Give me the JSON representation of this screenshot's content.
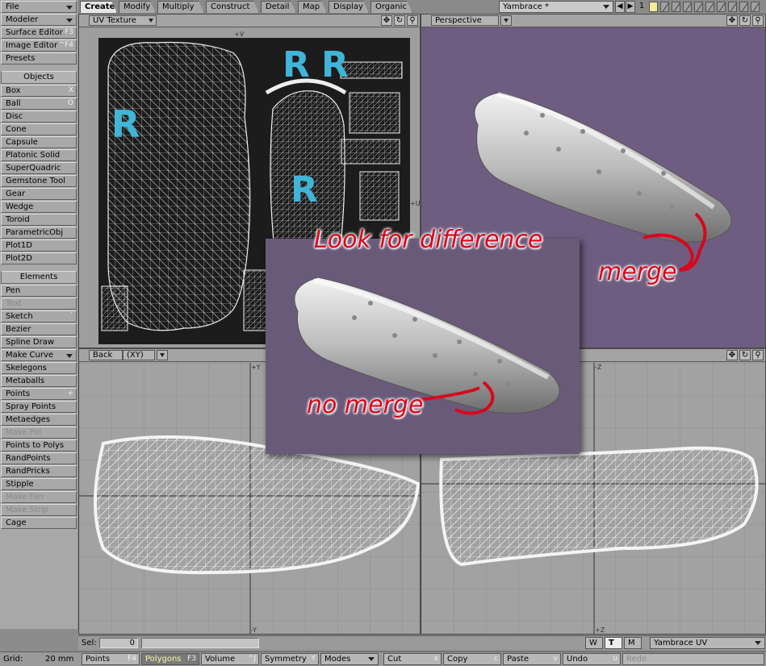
{
  "sidebar": {
    "file_label": "File",
    "modeler_label": "Modeler",
    "surface_editor": {
      "label": "Surface Editor",
      "shortcut": "F3"
    },
    "image_editor": {
      "label": "Image Editor",
      "shortcut": "^F4"
    },
    "presets_label": "Presets",
    "objects_header": "Objects",
    "objects": [
      {
        "label": "Box",
        "shortcut": "X"
      },
      {
        "label": "Ball",
        "shortcut": "O"
      },
      {
        "label": "Disc"
      },
      {
        "label": "Cone"
      },
      {
        "label": "Capsule"
      },
      {
        "label": "Platonic Solid"
      },
      {
        "label": "SuperQuadric"
      },
      {
        "label": "Gemstone Tool"
      },
      {
        "label": "Gear"
      },
      {
        "label": "Wedge"
      },
      {
        "label": "Toroid"
      },
      {
        "label": "ParametricObj"
      },
      {
        "label": "Plot1D"
      },
      {
        "label": "Plot2D"
      }
    ],
    "elements_header": "Elements",
    "elements": [
      {
        "label": "Pen"
      },
      {
        "label": "Text",
        "disabled": true
      },
      {
        "label": "Sketch",
        "shortcut": "`"
      },
      {
        "label": "Bezier"
      },
      {
        "label": "Spline Draw"
      },
      {
        "label": "Make Curve",
        "dropdown": true
      },
      {
        "label": "Skelegons"
      },
      {
        "label": "Metaballs"
      },
      {
        "label": "Points",
        "shortcut": "+"
      },
      {
        "label": "Spray Points"
      },
      {
        "label": "Metaedges"
      },
      {
        "label": "Make Pol",
        "disabled": true
      },
      {
        "label": "Points to Polys"
      },
      {
        "label": "RandPoints"
      },
      {
        "label": "RandPricks"
      },
      {
        "label": "Stipple"
      },
      {
        "label": "Make Fan",
        "disabled": true
      },
      {
        "label": "Make Strip",
        "disabled": true
      },
      {
        "label": "Cage"
      }
    ]
  },
  "tabs": [
    "Create",
    "Modify",
    "Multiply",
    "Construct",
    "Detail",
    "Map",
    "Display",
    "Organic"
  ],
  "header": {
    "file_name": "Yambrace *",
    "layer_number": "1"
  },
  "viewports": {
    "top_left": {
      "view": "UV Texture"
    },
    "top_right": {
      "view": "Perspective"
    },
    "bottom_left": {
      "view": "Back",
      "axes": "(XY)"
    }
  },
  "uv_labels": {
    "plus_v": "+V",
    "plus_u": "+U",
    "letters": [
      "R",
      "R",
      "R",
      "R"
    ]
  },
  "axis_labels": {
    "back_top": "+Y",
    "back_bottom": "-Y",
    "br_top": "-Z",
    "br_bottom": "+Z"
  },
  "annotations": {
    "look": "Look for difference",
    "merge": "merge",
    "no_merge": "no merge"
  },
  "status": {
    "sel_label": "Sel:",
    "sel_value": "0",
    "wtm": [
      "W",
      "T",
      "M"
    ],
    "surface": "Yambrace UV"
  },
  "bottom": {
    "grid_label": "Grid:",
    "grid_value": "20 mm",
    "points": {
      "label": "Points",
      "shortcut": "F4"
    },
    "polygons": {
      "label": "Polygons",
      "shortcut": "F3"
    },
    "volume": {
      "label": "Volume",
      "shortcut": "^J"
    },
    "symmetry": {
      "label": "Symmetry",
      "shortcut": "Y"
    },
    "modes": {
      "label": "Modes"
    },
    "cut": {
      "label": "Cut",
      "shortcut": "x"
    },
    "copy": {
      "label": "Copy",
      "shortcut": "c"
    },
    "paste": {
      "label": "Paste",
      "shortcut": "v"
    },
    "undo": {
      "label": "Undo",
      "shortcut": "u"
    },
    "redo": {
      "label": "Redo"
    }
  },
  "colors": {
    "panel": "#a8a8a8",
    "uv_bg": "#1a1a1a",
    "viewport_bg": "#a0a0a0",
    "perspective_bg": "#6e5d80",
    "annotation_red": "#d6081c",
    "uv_letter": "#3fb6d8",
    "active_text": "#f7f2a8"
  }
}
